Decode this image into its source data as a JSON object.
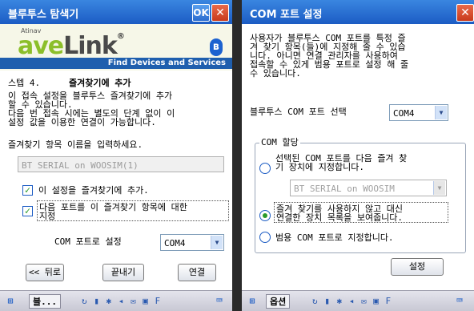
{
  "left": {
    "title": "블루투스 탐색기",
    "ok_label": "OK",
    "close_glyph": "✕",
    "banner": {
      "small": "Atinav",
      "logo_a": "ave",
      "logo_b": "Link",
      "mark": "®",
      "tagline": "Find Devices and Services",
      "bt_glyph": "ʙ"
    },
    "step": "스텝 4.",
    "step_title": "즐겨찾기에 추가",
    "desc": [
      "이 접속 설정을 블루투스 즐겨찾기에 추가",
      "할 수 있습니다.",
      "다음 번 접속 시에는 별도의 단계 없이 이",
      "설정 값을 이용한 연결이 가능합니다."
    ],
    "name_prompt": "즐겨찾기 항목 이름을 입력하세요.",
    "name_value": "BT SERIAL on WOOSIM(1)",
    "chk1_label": "이 설정을 즐겨찾기에 추가.",
    "chk2_label": [
      "다음 포트를 이 즐겨찾기 항목에 대한",
      "지정"
    ],
    "check_glyph": "✓",
    "com_label": "COM 포트로 설정",
    "com_value": "COM4",
    "buttons": {
      "back": "<< 뒤로",
      "finish": "끝내기",
      "connect": "연결"
    },
    "taskbar": {
      "win_glyph": "⊞",
      "app": "블...",
      "tray": "↻ ▮ ✱ ◂ ✉ ▣ F",
      "kb": "⌨"
    }
  },
  "right": {
    "title": "COM 포트 설정",
    "close_glyph": "✕",
    "desc": [
      "사용자가 블루투스 COM 포트를 특정 즐",
      "겨 찾기 항목(들)에 지정해 줄 수 있습",
      "니다. 아니면 연결 관리자를 사용하여",
      "접속할 수 있게 범용 포트로 설정 해 줄",
      "수 있습니다."
    ],
    "port_select_label": "블루투스 COM 포트 선택",
    "port_value": "COM4",
    "group_label": "COM 할당",
    "radio1_label": [
      "선택된 COM 포트를 다음 즐겨 찾",
      "기 장치에 지정합니다."
    ],
    "radio1_combo": "BT SERIAL on WOOSIM",
    "radio2_label": [
      "즐겨 찾기를 사용하지 않고 대신",
      "연결한 장치 목록을 보여줍니다."
    ],
    "radio3_label": "범용 COM 포트로 지정합니다.",
    "settings_button": "설정",
    "taskbar": {
      "win_glyph": "⊞",
      "menu": "옵션",
      "tray": "↻ ▮ ✱ ◂ ✉ ▣ F",
      "kb": "⌨"
    }
  },
  "colors": {
    "titlebar": "#1c5cc4",
    "check": "#2a9a2a",
    "tagline_bg": "#1f5fae"
  }
}
